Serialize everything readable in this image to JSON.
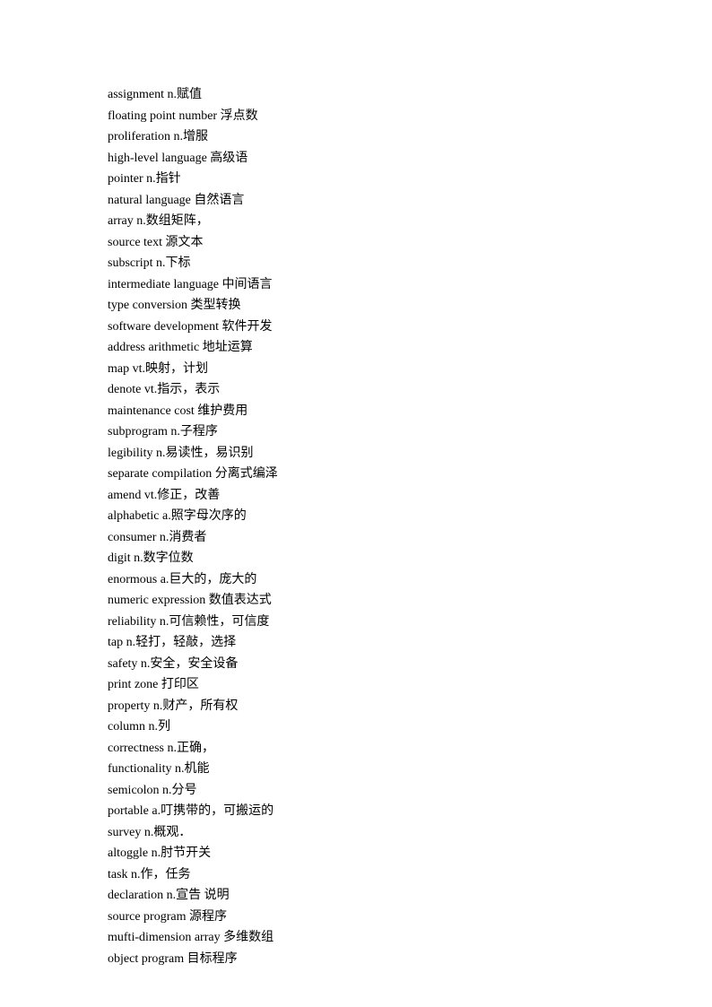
{
  "entries": [
    "assignment n.赋值",
    "floating point number 浮点数",
    "proliferation n.增服",
    "high-level language 高级语",
    "pointer n.指针",
    "natural language  自然语言",
    "array n.数组矩阵，",
    "source text  源文本",
    "subscript n.下标",
    "intermediate language  中间语言",
    "type conversion  类型转换",
    "software development  软件开发",
    "address arithmetic  地址运算",
    "map vt.映射，计划",
    "denote vt.指示，表示",
    "maintenance cost  维护费用",
    "subprogram n.子程序",
    "legibility n.易读性，易识别",
    "separate compilation  分离式编泽",
    "amend vt.修正，改善",
    "alphabetic a.照字母次序的",
    "consumer n.消费者",
    "digit n.数字位数",
    "enormous a.巨大的，庞大的",
    "numeric expression  数值表达式",
    "reliability n.可信赖性，可信度",
    "tap n.轻打，轻敲，选择",
    "safety n.安全，安全设备",
    "print zone  打印区",
    "property n.财产，所有权",
    "column n.列",
    "correctness n.正确，",
    "functionality n.机能",
    "semicolon n.分号",
    "portable a.叮携带的，可搬运的",
    "survey n.概观．",
    "altoggle n.肘节开关",
    "task n.作，任务",
    "declaration n.宣告  说明",
    "source program  源程序",
    "mufti-dimension array  多维数组",
    "object program  目标程序"
  ]
}
